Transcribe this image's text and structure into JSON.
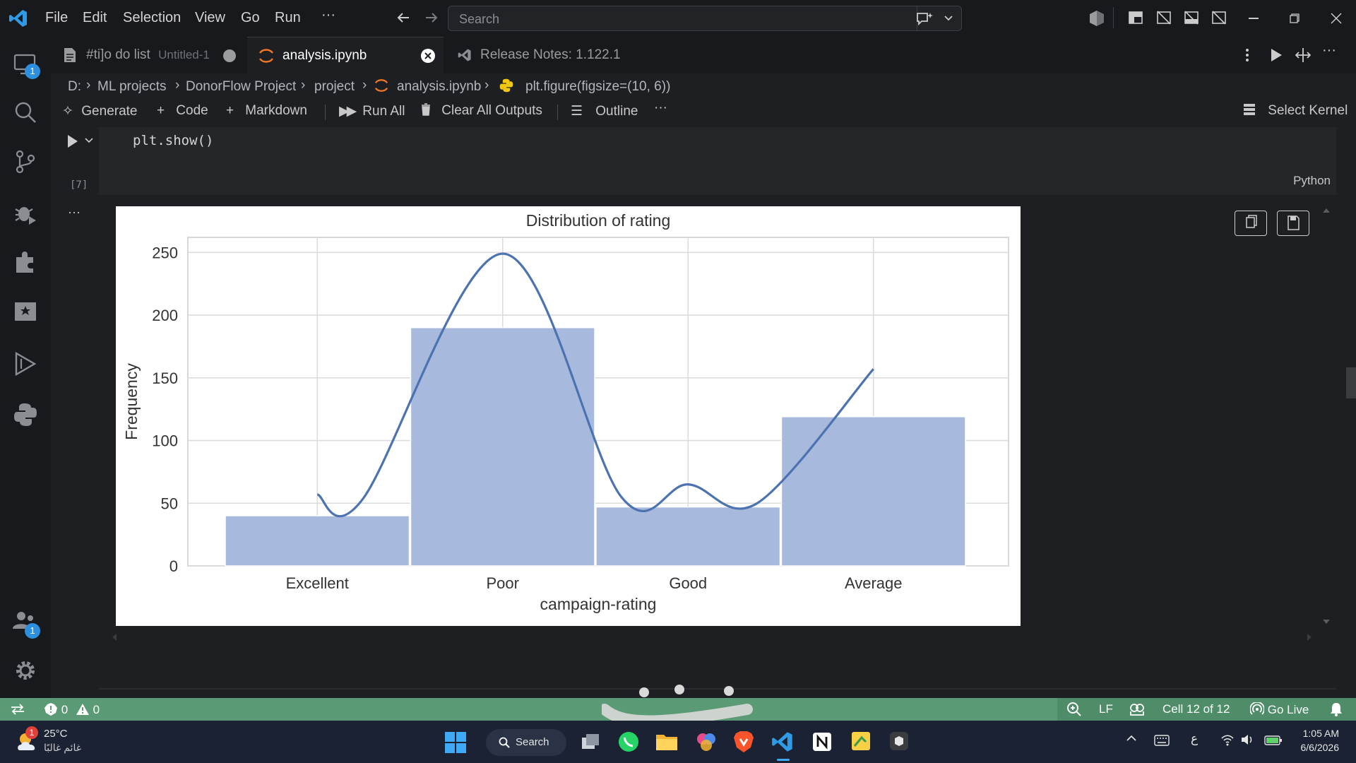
{
  "menu": {
    "file": "File",
    "edit": "Edit",
    "selection": "Selection",
    "view": "View",
    "go": "Go",
    "run": "Run",
    "more": "···",
    "search_placeholder": "Search"
  },
  "activity": {
    "remote_badge": "1",
    "accounts_badge": "1"
  },
  "tabs": [
    {
      "label": "#ti]o do list",
      "sub": "Untitled-1"
    },
    {
      "label": "analysis.ipynb"
    },
    {
      "label": "Release Notes: 1.122.1"
    }
  ],
  "breadcrumb": [
    "D:",
    "ML projects",
    "DonorFlow Project",
    "project",
    "analysis.ipynb",
    "plt.figure(figsize=(10, 6))"
  ],
  "toolbar": {
    "generate": "Generate",
    "code": "Code",
    "markdown": "Markdown",
    "run_all": "Run All",
    "clear_outputs": "Clear All Outputs",
    "outline": "Outline",
    "more": "···",
    "select_kernel": "Select Kernel"
  },
  "cell": {
    "code_line": "plt.show()",
    "exec_count": "[7]",
    "language": "Python",
    "more": "···"
  },
  "chart_data": {
    "type": "bar",
    "title": "Distribution of rating",
    "xlabel": "campaign-rating",
    "ylabel": "Frequency",
    "categories": [
      "Excellent",
      "Poor",
      "Good",
      "Average"
    ],
    "values": [
      40,
      190,
      47,
      119
    ],
    "kde": [
      57,
      249,
      65,
      157
    ],
    "ylim": [
      0,
      262
    ],
    "yticks": [
      0,
      50,
      100,
      150,
      200,
      250
    ],
    "grid": true,
    "bar_color": "#a7b9dc",
    "line_color": "#4c72b0"
  },
  "statusbar": {
    "errors": "0",
    "warnings": "0",
    "eol": "LF",
    "cell_pos": "Cell 12 of 12",
    "go_live": "Go Live",
    "color": "#5a9a74"
  },
  "taskbar": {
    "weather_temp": "25°C",
    "weather_desc": "غائم غالبًا",
    "weather_badge": "1",
    "search": "Search",
    "lang": "ع",
    "time": "1:05 AM",
    "date": "6/6/2026"
  }
}
